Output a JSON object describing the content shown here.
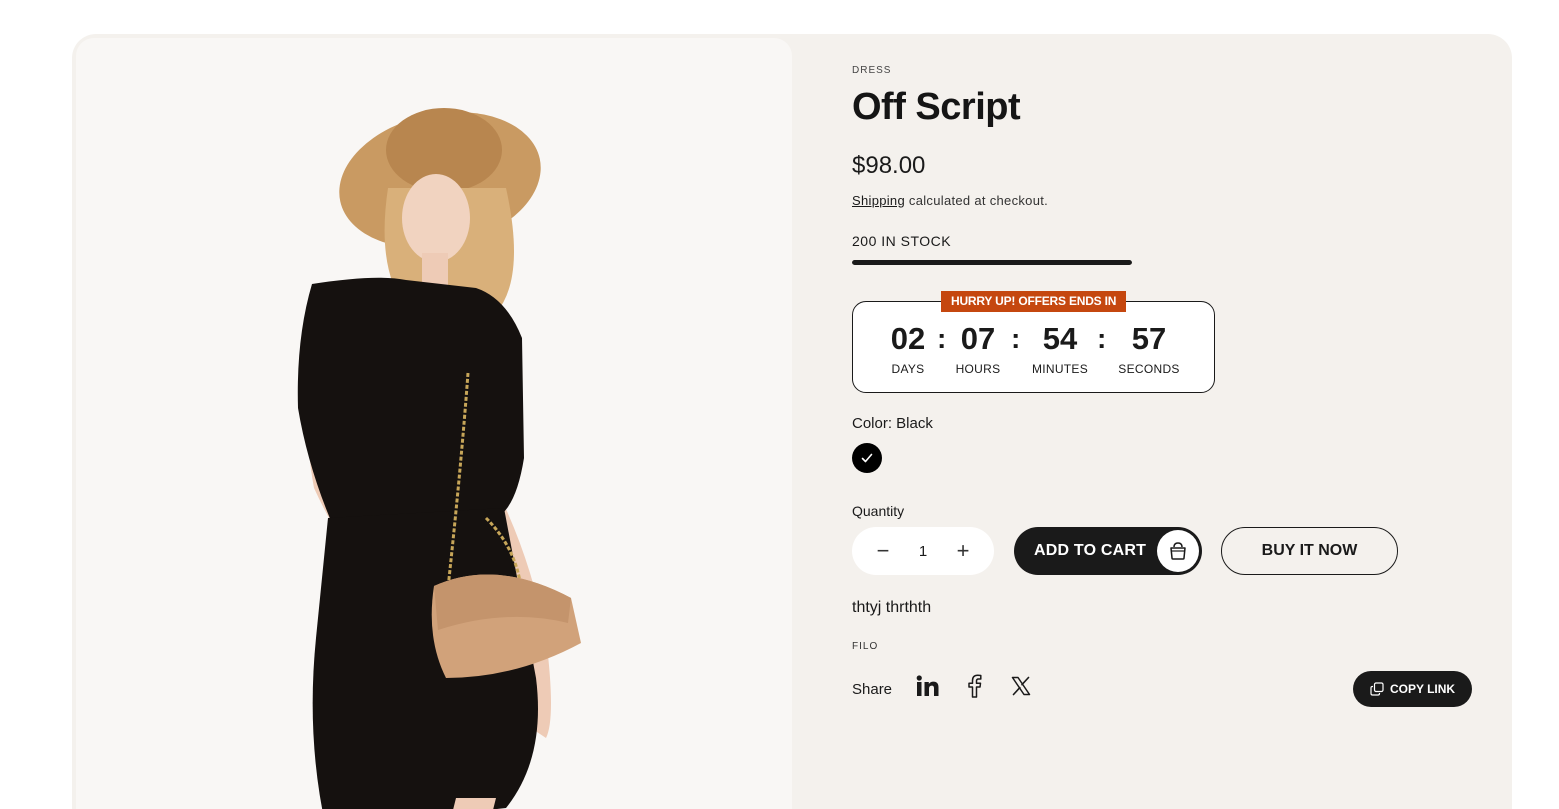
{
  "product": {
    "vendor": "DRESS",
    "title": "Off Script",
    "price": "$98.00",
    "shipping_link": "Shipping",
    "shipping_text": " calculated at checkout.",
    "stock_text": "200 IN STOCK",
    "stock_level": 1.0,
    "description": "thtyj thrthth",
    "brand": "FILO"
  },
  "countdown": {
    "banner": "HURRY UP! OFFERS ENDS IN",
    "units": [
      {
        "value": "02",
        "label": "DAYS"
      },
      {
        "value": "07",
        "label": "HOURS"
      },
      {
        "value": "54",
        "label": "MINUTES"
      },
      {
        "value": "57",
        "label": "SECONDS"
      }
    ],
    "separator": ":"
  },
  "variant": {
    "color_label": "Color: Black",
    "selected_color": "#000000",
    "swatch_icon": "checkmark-icon"
  },
  "quantity": {
    "label": "Quantity",
    "value": "1",
    "decrease_symbol": "−",
    "increase_symbol": "+"
  },
  "actions": {
    "add_to_cart": "ADD TO CART",
    "add_to_cart_icon": "shopping-bag-icon",
    "buy_now": "BUY IT NOW"
  },
  "share": {
    "label": "Share",
    "icons": [
      "linkedin-icon",
      "facebook-icon",
      "x-icon"
    ],
    "copy_link": "COPY LINK",
    "copy_icon": "copy-icon"
  },
  "colors": {
    "accent": "#c5470f",
    "background": "#f4f1ed",
    "dark": "#1a1a1a"
  }
}
